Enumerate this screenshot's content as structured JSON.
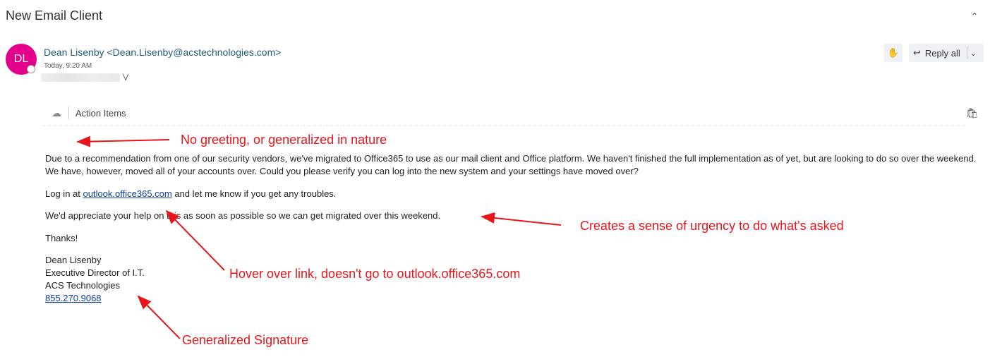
{
  "header": {
    "subject": "New Email Client",
    "collapse_icon": "double-chevron-up-icon"
  },
  "sender": {
    "avatar_initials": "DL",
    "avatar_color": "#e3008c",
    "display": "Dean Lisenby <Dean.Lisenby@acstechnologies.com>",
    "date": "Today, 9:20 AM"
  },
  "actions": {
    "like_icon": "thumbs-up-icon",
    "reply_icon": "reply-all-icon",
    "reply_label": "Reply all",
    "more_icon": "chevron-down-icon"
  },
  "addin_bar": {
    "label": "Action Items",
    "left_icon": "action-items-icon",
    "right_icon": "store-bag-icon"
  },
  "body": {
    "p1": "Due to a recommendation from one of our security vendors, we've migrated to Office365 to use as our mail client and Office platform. We haven't finished the full implementation as of yet, but are looking to do so over the weekend. We have, however, moved all of your accounts over. Could you please verify you can log into the new system and your settings have moved over?",
    "p2_before": "Log in at ",
    "p2_link": "outlook.office365.com",
    "p2_after": " and let me know if you get any troubles.",
    "p3": "We'd appreciate your help on this as soon as possible so we can get migrated over this weekend.",
    "p4": "Thanks!",
    "signature": {
      "name": "Dean Lisenby",
      "title": "Executive Director of I.T.",
      "company": "ACS Technologies",
      "phone": "855.270.9068"
    }
  },
  "annotations": {
    "greeting": "No greeting, or generalized in nature",
    "urgency": "Creates a sense of urgency to do what's asked",
    "link": "Hover over link, doesn't go to outlook.office365.com",
    "signature": "Generalized Signature",
    "color": "#e8151b"
  }
}
